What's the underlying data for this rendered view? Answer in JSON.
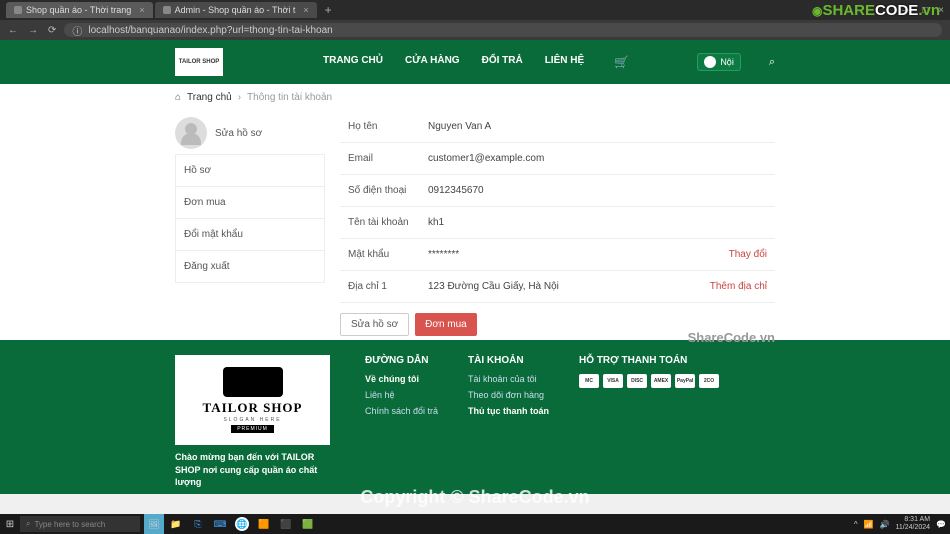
{
  "browser": {
    "tabs": [
      {
        "title": "Shop quần áo - Thời trang",
        "active": true
      },
      {
        "title": "Admin - Shop quần áo - Thời t",
        "active": false
      }
    ],
    "url": "localhost/banquanao/index.php?url=thong-tin-tai-khoan",
    "window_controls": {
      "min": "—",
      "max": "□",
      "close": "×"
    }
  },
  "header": {
    "logo_text": "TAILOR SHOP",
    "nav": {
      "home": "TRANG CHỦ",
      "store": "CỬA HÀNG",
      "returns": "ĐỔI TRẢ",
      "contact": "LIÊN HỆ"
    },
    "user_name": "Nội"
  },
  "breadcrumb": {
    "home": "Trang chủ",
    "current": "Thông tin tài khoản"
  },
  "sidebar": {
    "edit_profile": "Sửa hồ sơ",
    "items": [
      {
        "label": "Hồ sơ"
      },
      {
        "label": "Đơn mua"
      },
      {
        "label": "Đổi mật khẩu"
      },
      {
        "label": "Đăng xuất"
      }
    ]
  },
  "account": {
    "rows": [
      {
        "label": "Họ tên",
        "value": "Nguyen Van A",
        "action": ""
      },
      {
        "label": "Email",
        "value": "customer1@example.com",
        "action": ""
      },
      {
        "label": "Số điện thoại",
        "value": "0912345670",
        "action": ""
      },
      {
        "label": "Tên tài khoản",
        "value": "kh1",
        "action": ""
      },
      {
        "label": "Mật khẩu",
        "value": "********",
        "action": "Thay đổi"
      },
      {
        "label": "Địa chỉ 1",
        "value": "123 Đường Cầu Giấy, Hà Nội",
        "action": "Thêm địa chỉ"
      }
    ],
    "btn_edit": "Sửa hồ sơ",
    "btn_orders": "Đơn mua"
  },
  "footer": {
    "welcome": "Chào mừng bạn đến với TAILOR SHOP nơi cung cấp quần áo chất lượng",
    "col1": {
      "title": "ĐƯỜNG DẪN",
      "about": "Về chúng tôi",
      "contact": "Liên hệ",
      "policy": "Chính sách đổi trả"
    },
    "col2": {
      "title": "TÀI KHOẢN",
      "my_account": "Tài khoản của tôi",
      "orders": "Theo dõi đơn hàng",
      "payment": "Thủ tục thanh toán"
    },
    "col3": {
      "title": "HỖ TRỢ THANH TOÁN"
    },
    "logo": {
      "brand": "TAILOR SHOP",
      "slogan": "SLOGAN HERE",
      "premium": "PREMIUM"
    },
    "payments": [
      "MC",
      "VISA",
      "DISC",
      "AMEX",
      "PayPal",
      "2CO"
    ]
  },
  "watermarks": {
    "top_brand_1": "SHARE",
    "top_brand_2": "CODE",
    "top_brand_3": ".vn",
    "center": "ShareCode.vn",
    "bottom": "Copyright © ShareCode.vn"
  },
  "taskbar": {
    "search_placeholder": "Type here to search",
    "time": "8:31 AM",
    "date": "11/24/2024"
  }
}
